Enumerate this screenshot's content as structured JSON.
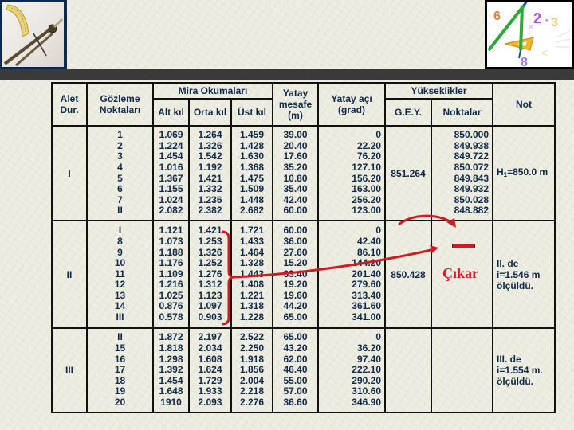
{
  "images": {
    "left": "drafting-compass-and-protractor-photo",
    "right": "math-clipart-compass-triangle-numbers"
  },
  "table": {
    "headers": {
      "alet_dur": "Alet Dur.",
      "gozleme": "Gözleme Noktaları",
      "mira_group": "Mira Okumaları",
      "alt": "Alt kıl",
      "orta": "Orta kıl",
      "ust": "Üst kıl",
      "yatay_mesafe": "Yatay mesafe (m)",
      "yatay_aci": "Yatay açı (grad)",
      "yukseklikler_group": "Yükseklikler",
      "gey": "G.E.Y.",
      "noktalar": "Noktalar",
      "not": "Not"
    },
    "groups": [
      {
        "station": "I",
        "points": "1\n2\n3\n4\n5\n6\n7\nII",
        "alt": "1.069\n1.224\n1.454\n1.016\n1.367\n1.155\n1.024\n2.082",
        "orta": "1.264\n1.326\n1.542\n1.192\n1.421\n1.332\n1.236\n2.382",
        "ust": "1.459\n1.428\n1.630\n1.368\n1.475\n1.509\n1.448\n2.682",
        "mesafe": "39.00\n20.40\n17.60\n35.20\n10.80\n35.40\n42.40\n60.00",
        "aci": "0\n22.20\n76.20\n127.10\n156.20\n163.00\n256.20\n123.00",
        "gey": "851.264",
        "noktalar": "850.000\n849.938\n849.722\n850.072\n849.843\n849.932\n850.028\n848.882",
        "not_prefix": "H",
        "not_sub": "1",
        "not_suffix": "=850.0 m"
      },
      {
        "station": "II",
        "points": "I\n8\n9\n10\n11\n12\n13\n14\nIII",
        "alt": "1.121\n1.073\n1.188\n1.176\n1.109\n1.216\n1.025\n0.876\n0.578",
        "orta": "1.421\n1.253\n1.326\n1.252\n1.276\n1.312\n1.123\n1.097\n0.903",
        "ust": "1.721\n1.433\n1.464\n1.328\n1.443\n1.408\n1.221\n1.318\n1.228",
        "mesafe": "60.00\n36.00\n27.60\n15.20\n33.40\n19.20\n19.60\n44.20\n65.00",
        "aci": "0\n42.40\n86.10\n144.20\n201.40\n279.60\n313.40\n361.60\n341.00",
        "gey": "850.428",
        "noktalar": "",
        "note": "II. de\ni=1.546 m\nölçüldü."
      },
      {
        "station": "III",
        "points": "II\n15\n16\n17\n18\n19\n20",
        "alt": "1.872\n1.818\n1.298\n1.392\n1.454\n1.648\n1910",
        "orta": "2.197\n2.034\n1.608\n1.624\n1.729\n1.933\n2.093",
        "ust": "2.522\n2.250\n1.918\n1.856\n2.004\n2.218\n2.276",
        "mesafe": "65.00\n43.20\n62.00\n46.40\n55.00\n57.00\n36.60",
        "aci": "0\n36.20\n97.40\n222.10\n290.20\n310.60\n346.90",
        "gey": "",
        "noktalar": "",
        "note": "III. de\ni=1.554 m.\nölçüldü."
      }
    ]
  },
  "annotations": {
    "minus_symbol": "minus-sign",
    "cikar_label": "Çıkar",
    "arrow_color": "#d11a22"
  }
}
